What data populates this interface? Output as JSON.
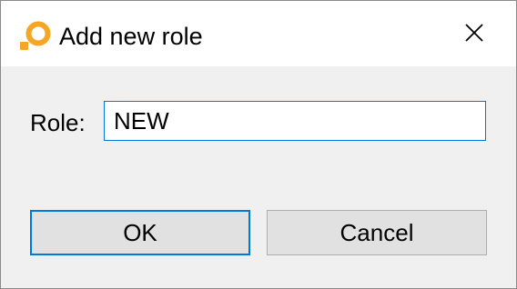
{
  "window": {
    "title": "Add new role",
    "app_icon": "app-ring-icon",
    "close_icon": "close-icon"
  },
  "form": {
    "role_label": "Role:",
    "role_value": "NEW"
  },
  "buttons": {
    "ok_label": "OK",
    "cancel_label": "Cancel"
  },
  "colors": {
    "accent": "#0078d7",
    "icon_orange": "#f5a623",
    "dialog_bg": "#f0f0f0",
    "titlebar_bg": "#ffffff",
    "button_bg": "#e1e1e1"
  }
}
